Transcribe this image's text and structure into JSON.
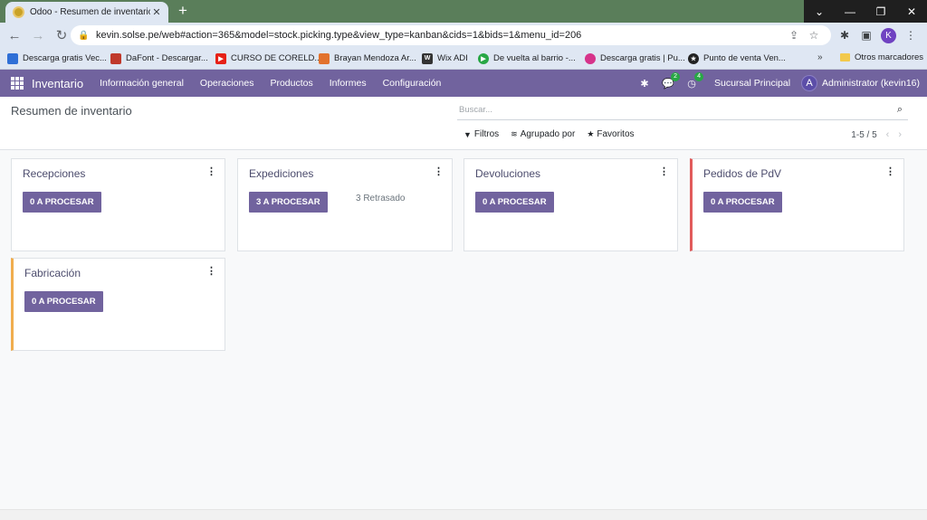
{
  "browser": {
    "tab_title": "Odoo - Resumen de inventario",
    "url": "kevin.solse.pe/web#action=365&model=stock.picking.type&view_type=kanban&cids=1&bids=1&menu_id=206",
    "profile_initial": "K",
    "bookmarks": [
      {
        "label": "Descarga gratis Vec...",
        "color": "#2f6fd6"
      },
      {
        "label": "DaFont - Descargar...",
        "color": "#c0392b"
      },
      {
        "label": "CURSO DE CORELD...",
        "color": "#e62117"
      },
      {
        "label": "Brayan Mendoza Ar...",
        "color": "#e2722d"
      },
      {
        "label": "Wix ADI",
        "color": "#333333"
      },
      {
        "label": "De vuelta al barrio -...",
        "color": "#28a745"
      },
      {
        "label": "Descarga gratis | Pu...",
        "color": "#d6338a"
      },
      {
        "label": "Punto de venta Ven...",
        "color": "#222222"
      }
    ],
    "bookmarks_more": "»",
    "other_bookmarks": "Otros marcadores"
  },
  "navbar": {
    "brand": "Inventario",
    "menu": [
      "Información general",
      "Operaciones",
      "Productos",
      "Informes",
      "Configuración"
    ],
    "messages_count": "2",
    "activities_count": "4",
    "company": "Sucursal Principal",
    "user_initial": "A",
    "user": "Administrator (kevin16)"
  },
  "control_panel": {
    "breadcrumb": "Resumen de inventario",
    "search_placeholder": "Buscar...",
    "filters": "Filtros",
    "group_by": "Agrupado por",
    "favorites": "Favoritos",
    "pager": "1-5 / 5"
  },
  "kanban": [
    {
      "title": "Recepciones",
      "button": "0 A PROCESAR",
      "late": ""
    },
    {
      "title": "Expediciones",
      "button": "3 A PROCESAR",
      "late": "3 Retrasado"
    },
    {
      "title": "Devoluciones",
      "button": "0 A PROCESAR",
      "late": ""
    },
    {
      "title": "Pedidos de PdV",
      "button": "0 A PROCESAR",
      "late": ""
    },
    {
      "title": "Fabricación",
      "button": "0 A PROCESAR",
      "late": ""
    }
  ],
  "colors": {
    "odoo_purple": "#71639e",
    "accent_red": "#e15b5b",
    "accent_orange": "#f0ad4e"
  }
}
